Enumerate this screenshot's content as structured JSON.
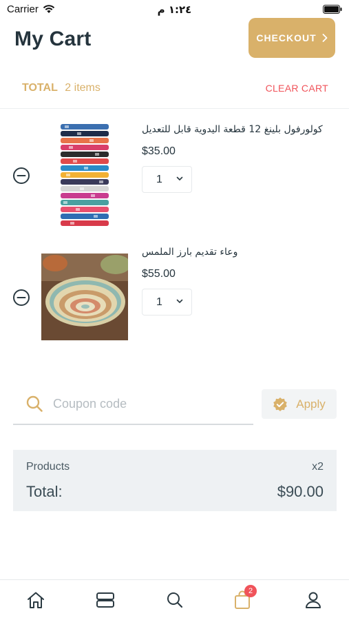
{
  "status_bar": {
    "carrier": "Carrier",
    "time": "١:٢٤ م"
  },
  "header": {
    "title": "My Cart",
    "checkout_label": "CHECKOUT"
  },
  "summary_bar": {
    "total_label": "TOTAL",
    "items_count": "2 items",
    "clear_label": "CLEAR CART"
  },
  "cart_items": [
    {
      "title": "كولورفول بلينغ 12 قطعة اليدوية قابل للتعديل",
      "price": "$35.00",
      "quantity": "1",
      "image": "stacked-bracelets"
    },
    {
      "title": "وعاء تقديم بارز الملمس",
      "price": "$55.00",
      "quantity": "1",
      "image": "woven-basket-bowl"
    }
  ],
  "coupon": {
    "placeholder": "Coupon code",
    "value": "",
    "apply_label": "Apply"
  },
  "order_summary": {
    "products_label": "Products",
    "products_count": "x2",
    "total_label": "Total:",
    "total_value": "$90.00"
  },
  "tab_bar": {
    "tabs": [
      {
        "icon": "home-icon"
      },
      {
        "icon": "categories-icon"
      },
      {
        "icon": "search-icon"
      },
      {
        "icon": "cart-icon",
        "badge": "2",
        "active": true
      },
      {
        "icon": "profile-icon"
      }
    ]
  },
  "colors": {
    "accent": "#d9b16a",
    "danger": "#f0535a",
    "text": "#25343d",
    "summary_bg": "#eef1f3"
  }
}
